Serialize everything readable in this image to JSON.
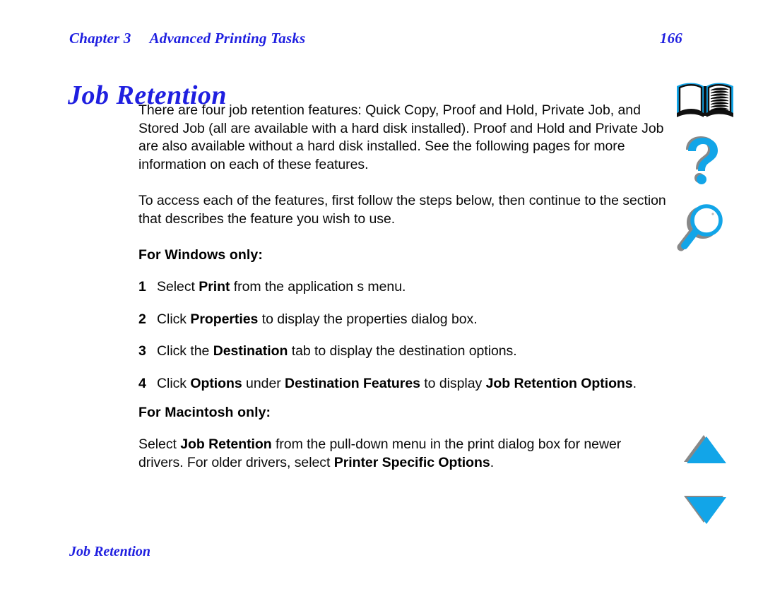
{
  "header": {
    "chapter": "Chapter 3",
    "section_title": "Advanced Printing Tasks",
    "page_number": "166"
  },
  "title": "Job Retention",
  "body": {
    "paragraph_1": "There are four job retention features: Quick Copy, Proof and Hold, Private Job, and Stored Job (all are available with a hard disk installed). Proof and Hold and Private Job are also available without a hard disk installed. See the following pages for more information on each of these features.",
    "paragraph_2": "To access each of the features, first follow the steps below, then continue to the section that describes the feature you wish to use.",
    "windows_heading": "For Windows only:",
    "steps": [
      {
        "number": "1",
        "text_before": "Select ",
        "bold_1": "Print",
        "text_after": " from the application s menu."
      },
      {
        "number": "2",
        "text_before": "Click ",
        "bold_1": "Properties",
        "text_after": " to display the properties dialog box."
      },
      {
        "number": "3",
        "text_before": "Click the ",
        "bold_1": "Destination",
        "text_after": " tab to display the destination options."
      },
      {
        "number": "4",
        "text_before": "Click ",
        "bold_1": "Options",
        "text_mid_1": " under ",
        "bold_2": "Destination Features",
        "text_mid_2": " to display ",
        "bold_3": "Job Retention Options",
        "text_after": "."
      }
    ],
    "macintosh_heading": "For Macintosh only:",
    "macintosh_text": {
      "text_before": "Select ",
      "bold_1": "Job Retention",
      "text_mid_1": " from the pull-down menu in the print dialog box for newer drivers. For older drivers, select ",
      "bold_2": "Printer Specific Options",
      "text_after": "."
    }
  },
  "footer": {
    "section_label": "Job Retention"
  },
  "icon_rail": [
    {
      "name": "book-icon",
      "label": "Table of Contents"
    },
    {
      "name": "question-mark-icon",
      "label": "Help"
    },
    {
      "name": "magnifier-icon",
      "label": "Search"
    },
    {
      "name": "triangle-up-icon",
      "label": "Previous page"
    },
    {
      "name": "triangle-down-icon",
      "label": "Next page"
    }
  ],
  "colors": {
    "heading_blue": "#1F1FE0",
    "icon_cyan": "#12A5E8",
    "icon_shadow": "#808080",
    "body_text": "#0A0A0A",
    "page_background": "#FFFFFF"
  }
}
